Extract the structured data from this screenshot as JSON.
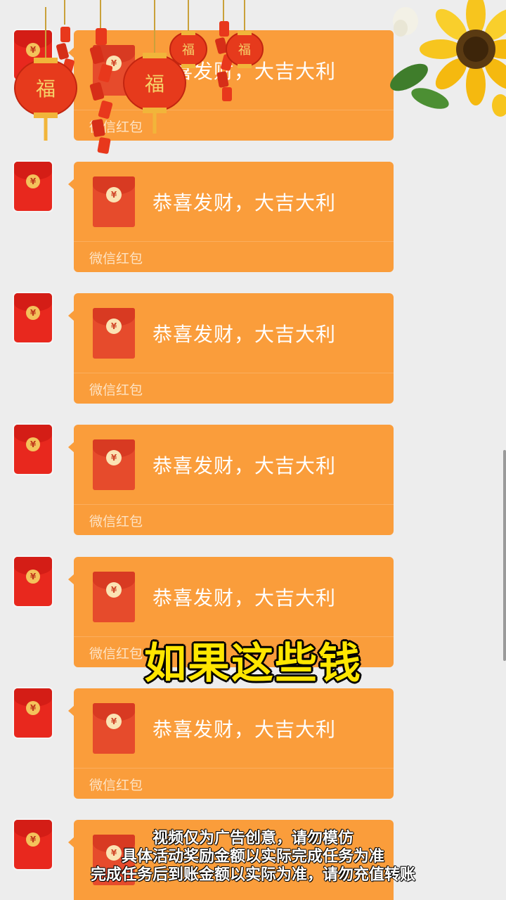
{
  "chat": {
    "messages": [
      {
        "greeting": "恭喜发财，大吉大利",
        "label": "微信红包"
      },
      {
        "greeting": "恭喜发财，大吉大利",
        "label": "微信红包"
      },
      {
        "greeting": "恭喜发财，大吉大利",
        "label": "微信红包"
      },
      {
        "greeting": "恭喜发财，大吉大利",
        "label": "微信红包"
      },
      {
        "greeting": "恭喜发财，大吉大利",
        "label": "微信红包"
      },
      {
        "greeting": "恭喜发财，大吉大利",
        "label": "微信红包"
      },
      {
        "greeting": "",
        "label": ""
      }
    ],
    "currency_symbol": "¥"
  },
  "lanterns": {
    "character": "福"
  },
  "caption": "如果这些钱",
  "disclaimer": {
    "line1": "视频仅为广告创意，请勿模仿",
    "line2": "具体活动奖励金额以实际完成任务为准",
    "line3": "完成任务后到账金额以实际为准，请勿充值转账"
  },
  "colors": {
    "background": "#ededed",
    "bubble": "#fa9d3b",
    "envelope": "#e64b2c",
    "caption": "#ffe600"
  }
}
